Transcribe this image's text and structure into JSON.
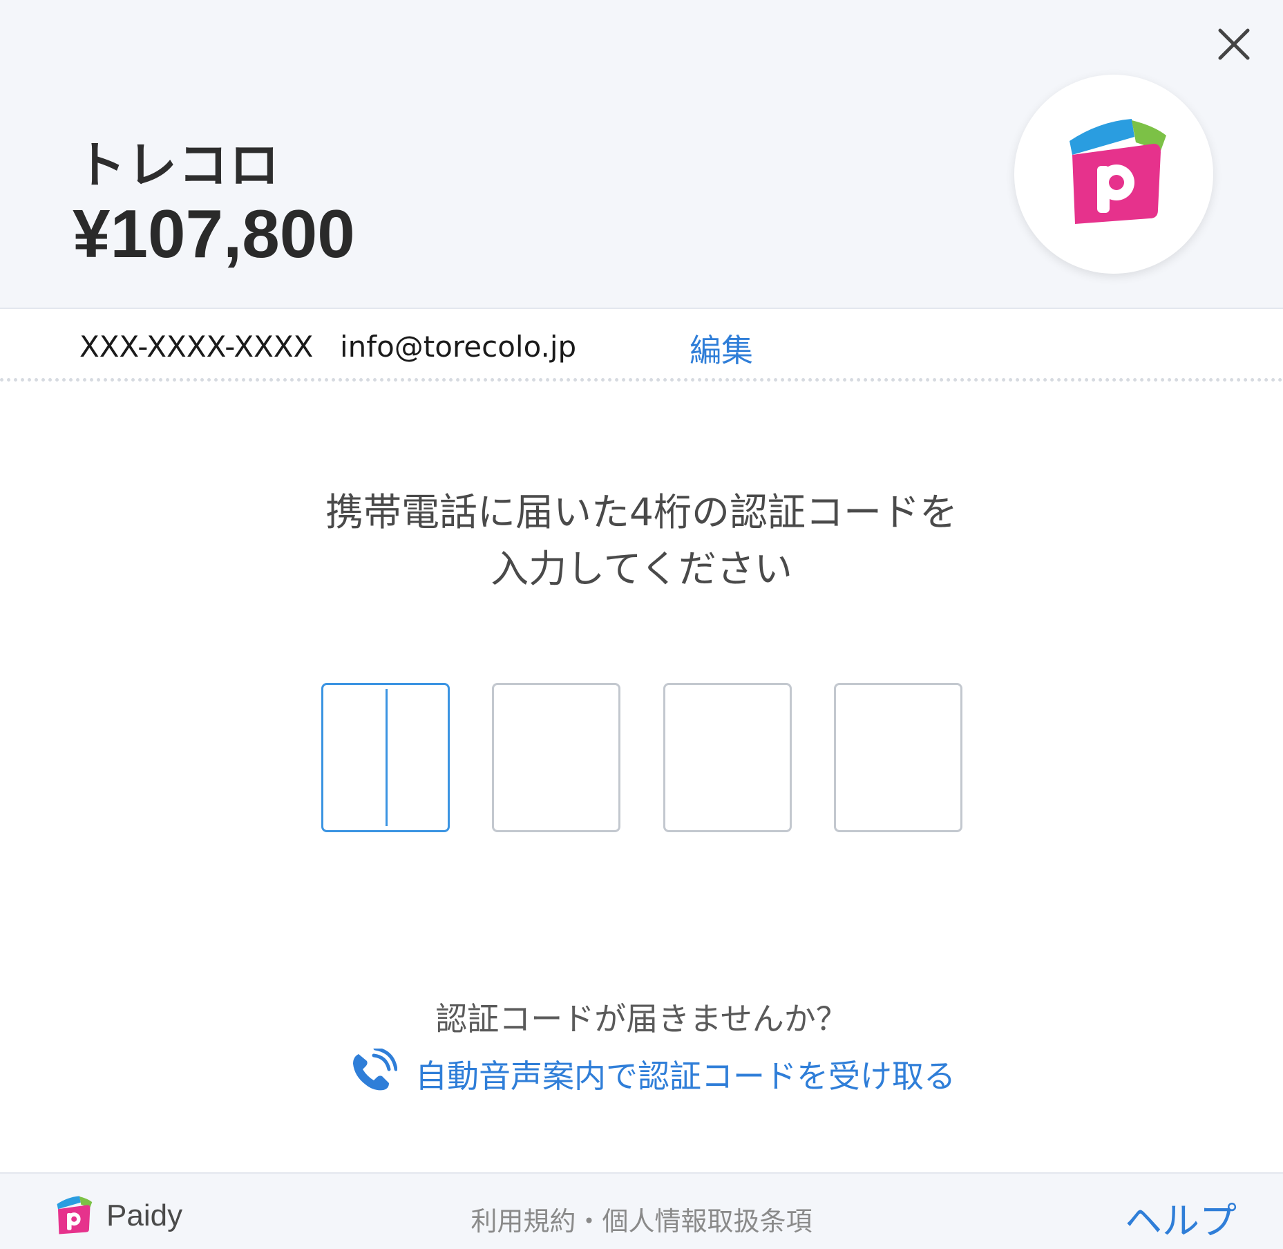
{
  "header": {
    "merchant_name": "トレコロ",
    "amount": "¥107,800"
  },
  "contact": {
    "phone": "XXX-XXXX-XXXX",
    "email": "info@torecolo.jp",
    "edit_label": "編集"
  },
  "verification": {
    "instruction_line1": "携帯電話に届いた4桁の認証コードを",
    "instruction_line2": "入力してください",
    "code_digits": [
      "",
      "",
      "",
      ""
    ],
    "no_code_question": "認証コードが届きませんか？",
    "voice_link_label": "自動音声案内で認証コードを受け取る"
  },
  "footer": {
    "brand": "Paidy",
    "terms": "利用規約・個人情報取扱条項",
    "help": "ヘルプ"
  },
  "colors": {
    "accent_blue": "#2f7ed8",
    "brand_pink": "#e6328c",
    "brand_blue": "#2a9de0",
    "brand_green": "#7cc146",
    "header_bg": "#f4f6fa"
  },
  "icons": {
    "close": "close-icon",
    "brand_logo": "paidy-logo-icon",
    "phone": "phone-call-icon"
  }
}
